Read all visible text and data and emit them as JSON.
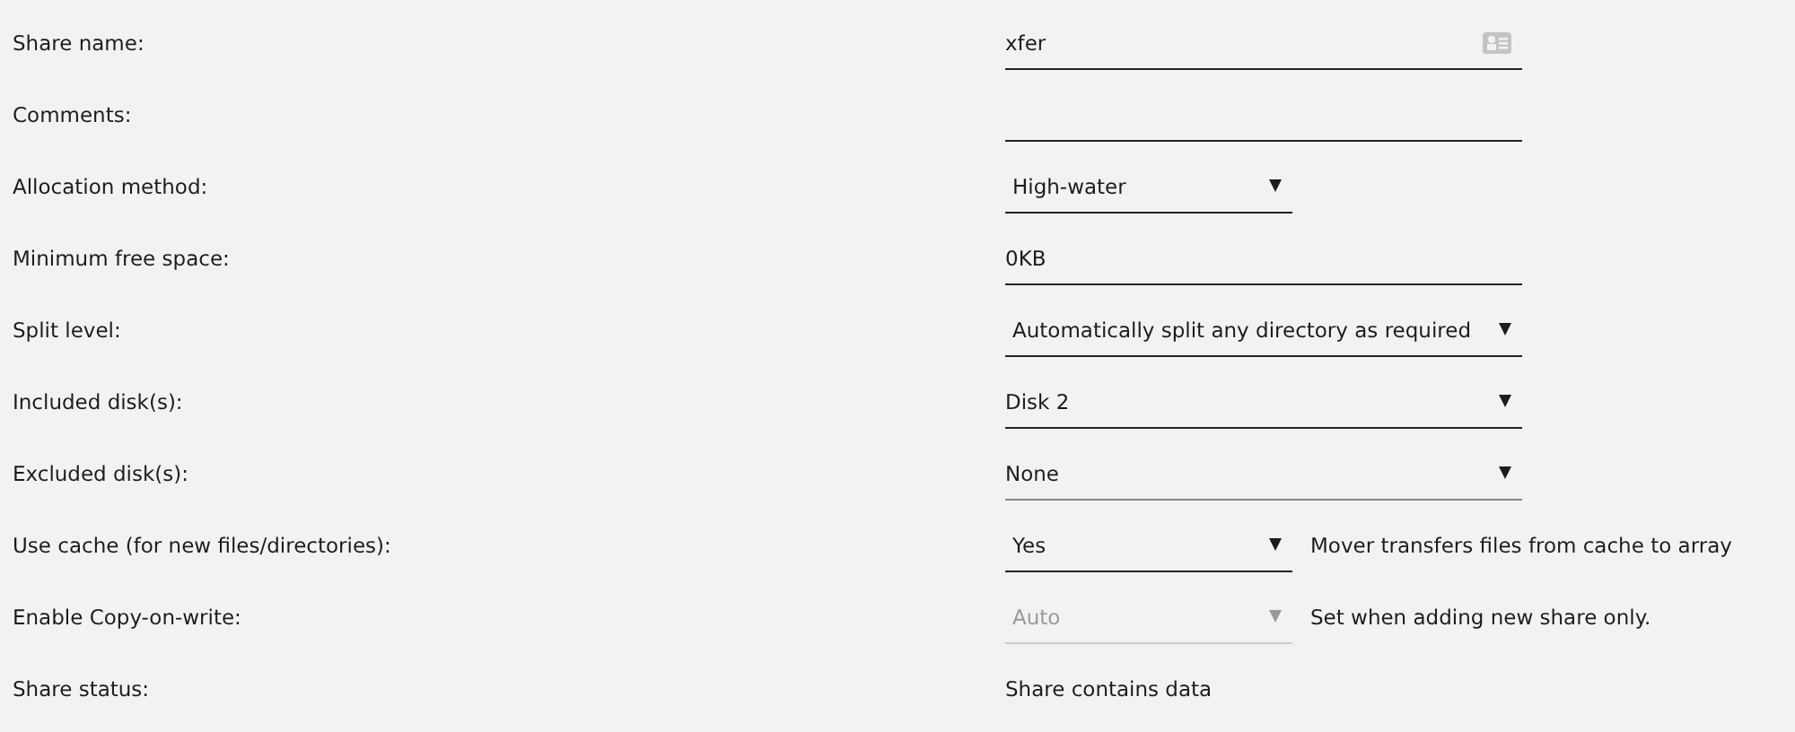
{
  "fields": [
    {
      "label": "Share name:",
      "kind": "input",
      "value": "xfer",
      "card_icon": true
    },
    {
      "label": "Comments:",
      "kind": "input"
    },
    {
      "label": "Allocation method:",
      "kind": "short-select",
      "value": "High-water",
      "disabled": false
    },
    {
      "label": "Minimum free space:",
      "kind": "input",
      "value": "0KB"
    },
    {
      "label": "Split level:",
      "kind": "select",
      "value": "Automatically split any directory as required",
      "disabled": false
    },
    {
      "label": "Included disk(s):",
      "kind": "multi-select",
      "value": "Disk 2"
    },
    {
      "label": "Excluded disk(s):",
      "kind": "multi-select",
      "value": "None"
    },
    {
      "label": "Use cache (for new files/directories):",
      "kind": "short-select",
      "value": "Yes",
      "disabled": false,
      "note": "Mover transfers files from cache to array"
    },
    {
      "label": "Enable Copy-on-write:",
      "kind": "short-select",
      "value": "Auto",
      "disabled": true,
      "note": "Set when adding new share only."
    },
    {
      "label": "Share status:",
      "kind": "text",
      "value": "Share contains data"
    }
  ]
}
